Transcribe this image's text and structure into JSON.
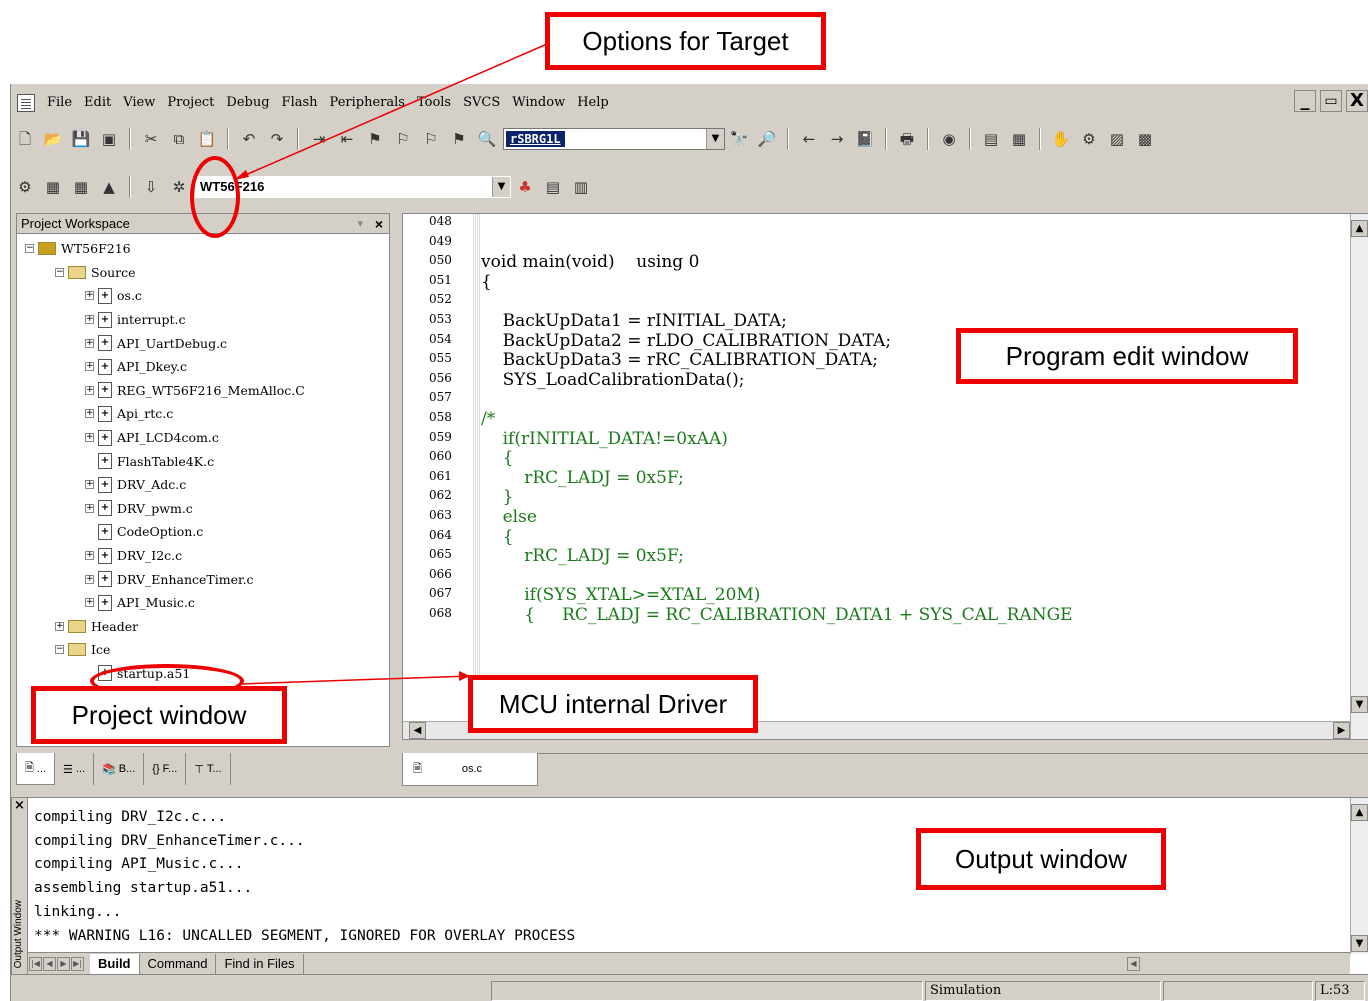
{
  "menubar": {
    "items": [
      "File",
      "Edit",
      "View",
      "Project",
      "Debug",
      "Flash",
      "Peripherals",
      "Tools",
      "SVCS",
      "Window",
      "Help"
    ]
  },
  "window_controls": {
    "minimize": "_",
    "restore": "🗗",
    "close": "X"
  },
  "toolbar": {
    "find_value": "rSBRG1L",
    "target_value": "WT56F216"
  },
  "workspace": {
    "title": "Project Workspace",
    "project": "WT56F216",
    "groups": [
      {
        "name": "Source",
        "files": [
          "os.c",
          "interrupt.c",
          "API_UartDebug.c",
          "API_Dkey.c",
          "REG_WT56F216_MemAlloc.C",
          "Api_rtc.c",
          "API_LCD4com.c",
          "FlashTable4K.c",
          "DRV_Adc.c",
          "DRV_pwm.c",
          "CodeOption.c",
          "DRV_I2c.c",
          "DRV_EnhanceTimer.c",
          "API_Music.c"
        ]
      },
      {
        "name": "Header",
        "files": []
      },
      {
        "name": "Ice",
        "files": [
          "startup.a51"
        ]
      }
    ],
    "tabs": [
      "...",
      "...",
      "B...",
      "F...",
      "T..."
    ]
  },
  "editor": {
    "line_numbers": [
      "048",
      "049",
      "050",
      "051",
      "052",
      "053",
      "054",
      "055",
      "056",
      "057",
      "058",
      "059",
      "060",
      "061",
      "062",
      "063",
      "064",
      "065",
      "066",
      "067",
      "068"
    ],
    "lines": [
      "",
      "",
      "void main(void)    using 0",
      "{",
      "",
      "    BackUpData1 = rINITIAL_DATA;",
      "    BackUpData2 = rLDO_CALIBRATION_DATA;",
      "    BackUpData3 = rRC_CALIBRATION_DATA;",
      "    SYS_LoadCalibrationData();",
      "",
      "/*",
      "    if(rINITIAL_DATA!=0xAA)",
      "    {",
      "        rRC_LADJ = 0x5F;",
      "    }",
      "    else",
      "    {",
      "        rRC_LADJ = 0x5F;",
      "",
      "        if(SYS_XTAL>=XTAL_20M)",
      "        {     RC_LADJ = RC_CALIBRATION_DATA1 + SYS_CAL_RANGE"
    ],
    "tab_label": "os.c"
  },
  "output": {
    "side_label": "Output Window",
    "lines": [
      "compiling DRV_I2c.c...",
      "compiling DRV_EnhanceTimer.c...",
      "compiling API_Music.c...",
      "assembling startup.a51...",
      "linking...",
      "*** WARNING L16: UNCALLED SEGMENT, IGNORED FOR OVERLAY PROCESS"
    ],
    "tabs": [
      "Build",
      "Command",
      "Find in Files"
    ]
  },
  "status": {
    "mode": "Simulation",
    "position": "L:53"
  },
  "annotations": {
    "options_for_target": "Options for Target",
    "program_edit_window": "Program edit window",
    "project_window": "Project window",
    "mcu_internal_driver": "MCU internal Driver",
    "output_window": "Output window"
  },
  "colors": {
    "annotation": "#e00000",
    "comment": "#1a7a1a",
    "chrome": "#d4d0c8"
  }
}
